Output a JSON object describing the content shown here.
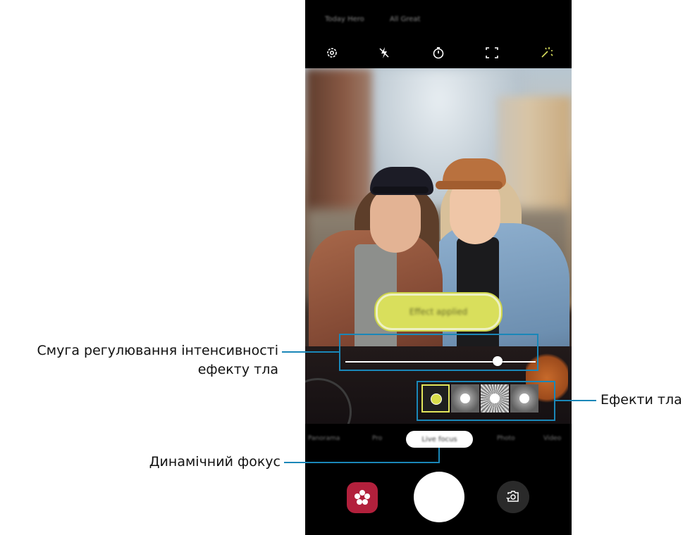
{
  "status_bar": {
    "left_text": "Today Hero",
    "right_text": "All Great"
  },
  "top_bar": {
    "icons": [
      "settings-icon",
      "flash-off-icon",
      "timer-icon",
      "aspect-ratio-icon",
      "filters-icon"
    ]
  },
  "viewfinder": {
    "status_pill": "Effect applied",
    "blur_slider": {
      "level": 0.8
    },
    "effects": [
      {
        "name": "blur",
        "selected": true
      },
      {
        "name": "spin",
        "selected": false
      },
      {
        "name": "zoom",
        "selected": false
      },
      {
        "name": "color-point",
        "selected": false
      }
    ]
  },
  "modes": {
    "items": [
      "Panorama",
      "Pro",
      "Live focus",
      "Photo",
      "Video"
    ],
    "active": "Live focus"
  },
  "bottom_bar": {
    "bixby_icon": "bixby-vision-icon",
    "shutter": "shutter-button",
    "switch_icon": "switch-camera-icon"
  },
  "annotations": {
    "slider_label_line1": "Смуга регулювання інтенсивності",
    "slider_label_line2": "ефекту тла",
    "effects_label": "Ефекти тла",
    "live_focus_label": "Динамічний фокус"
  },
  "colors": {
    "callout": "#1a87b8",
    "accent": "#d9df5c",
    "bixby": "#b2203c"
  }
}
